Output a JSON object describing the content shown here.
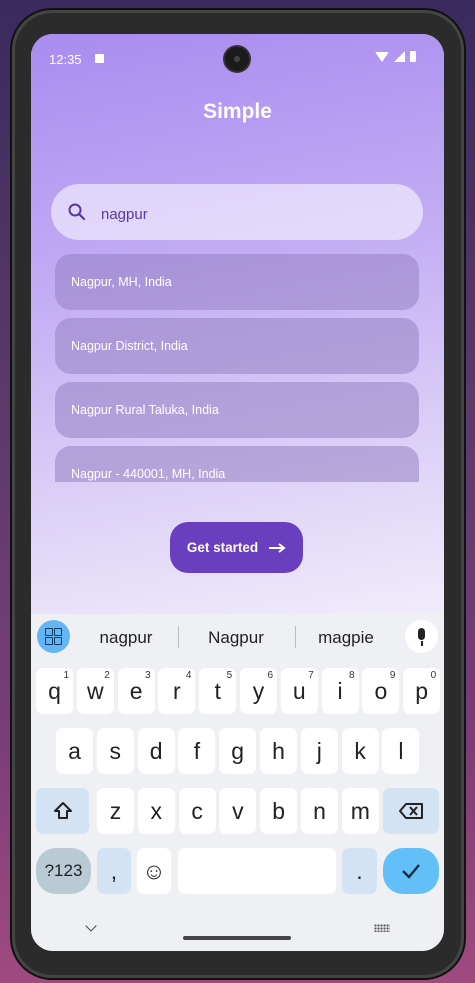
{
  "status": {
    "time": "12:35"
  },
  "app": {
    "title": "Simple",
    "search": {
      "value": "nagpur",
      "placeholder": ""
    },
    "suggestions": [
      "Nagpur, MH, India",
      "Nagpur District, India",
      "Nagpur Rural Taluka, India",
      "Nagpur - 440001, MH, India"
    ],
    "cta_label": "Get started",
    "cta_icon": "arrow-right-icon"
  },
  "keyboard": {
    "suggestions": [
      "nagpur",
      "Nagpur",
      "magpie"
    ],
    "row1": [
      {
        "k": "q",
        "sup": "1"
      },
      {
        "k": "w",
        "sup": "2"
      },
      {
        "k": "e",
        "sup": "3"
      },
      {
        "k": "r",
        "sup": "4"
      },
      {
        "k": "t",
        "sup": "5"
      },
      {
        "k": "y",
        "sup": "6"
      },
      {
        "k": "u",
        "sup": "7"
      },
      {
        "k": "i",
        "sup": "8"
      },
      {
        "k": "o",
        "sup": "9"
      },
      {
        "k": "p",
        "sup": "0"
      }
    ],
    "row2": [
      "a",
      "s",
      "d",
      "f",
      "g",
      "h",
      "j",
      "k",
      "l"
    ],
    "row3": [
      "z",
      "x",
      "c",
      "v",
      "b",
      "n",
      "m"
    ],
    "sym_label": "?123",
    "comma_label": ",",
    "emoji_label": "☺",
    "period_label": ".",
    "shift_icon": "shift-icon",
    "backspace_icon": "backspace-icon",
    "enter_icon": "checkmark-icon"
  },
  "colors": {
    "accent": "#6a3fbf",
    "enter_key": "#63bff8"
  }
}
